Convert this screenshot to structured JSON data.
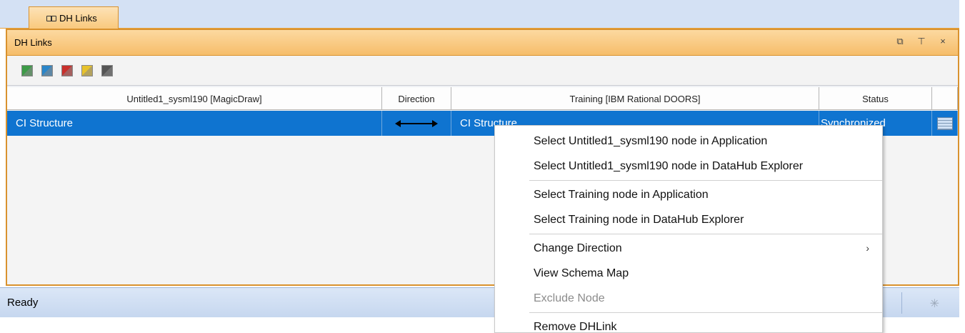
{
  "tab": {
    "label": "DH Links"
  },
  "panel": {
    "title": "DH Links",
    "controls": {
      "float": "⧉",
      "pin": "⊤",
      "close": "×"
    }
  },
  "toolbar": {
    "buttons": [
      {
        "name": "green-link-icon",
        "color": "#3d9b47"
      },
      {
        "name": "blue-link-icon",
        "color": "#2b86c9"
      },
      {
        "name": "red-link-icon",
        "color": "#c9302c"
      },
      {
        "name": "yellow-link-icon",
        "color": "#e7c22c"
      },
      {
        "name": "gray-link-icon",
        "color": "#555555"
      }
    ]
  },
  "grid": {
    "columns": [
      "Untitled1_sysml190 [MagicDraw]",
      "Direction",
      "Training [IBM Rational DOORS]",
      "Status",
      ""
    ],
    "rows": [
      {
        "source": "CI Structure",
        "direction": "bidirectional",
        "target": "CI Structure",
        "status": "Synchronized"
      }
    ]
  },
  "status_bar": {
    "text": "Ready"
  },
  "context_menu": {
    "items": [
      {
        "label": "Select Untitled1_sysml190 node in Application",
        "enabled": true
      },
      {
        "label": "Select Untitled1_sysml190 node in DataHub Explorer",
        "enabled": true
      },
      {
        "label": "Select Training node in Application",
        "enabled": true
      },
      {
        "label": "Select Training node in DataHub Explorer",
        "enabled": true
      },
      {
        "label": "Change Direction",
        "enabled": true,
        "submenu": true
      },
      {
        "label": "View Schema Map",
        "enabled": true
      },
      {
        "label": "Exclude Node",
        "enabled": false
      },
      {
        "label": "Remove DHLink",
        "enabled": true
      }
    ],
    "submenu_arrow": "›"
  },
  "colors": {
    "accent": "#0f74d0",
    "panel_border": "#d9922e",
    "statusbar": "#c6d7ef"
  }
}
